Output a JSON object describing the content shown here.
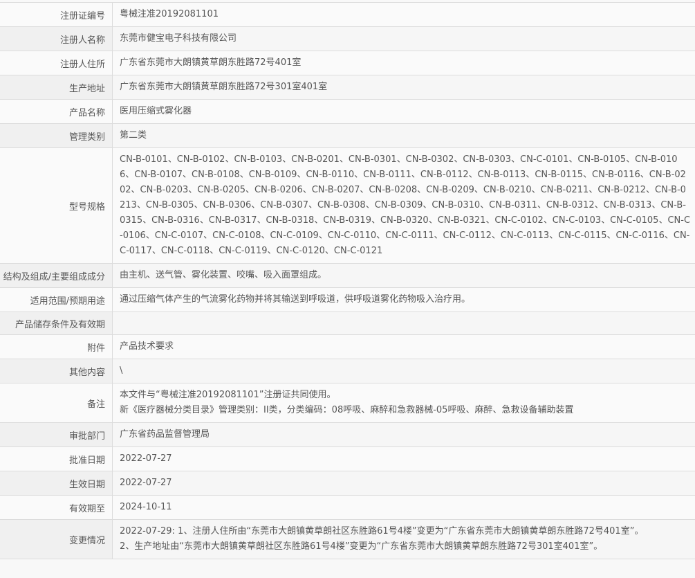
{
  "rows": [
    {
      "label": "注册证编号",
      "value": "粤械注准20192081101"
    },
    {
      "label": "注册人名称",
      "value": "东莞市健宝电子科技有限公司"
    },
    {
      "label": "注册人住所",
      "value": "广东省东莞市大朗镇黄草朗东胜路72号401室"
    },
    {
      "label": "生产地址",
      "value": "广东省东莞市大朗镇黄草朗东胜路72号301室401室"
    },
    {
      "label": "产品名称",
      "value": "医用压缩式雾化器"
    },
    {
      "label": "管理类别",
      "value": "第二类"
    },
    {
      "label": "型号规格",
      "value": "CN-B-0101、CN-B-0102、CN-B-0103、CN-B-0201、CN-B-0301、CN-B-0302、CN-B-0303、CN-C-0101、CN-B-0105、CN-B-0106、CN-B-0107、CN-B-0108、CN-B-0109、CN-B-0110、CN-B-0111、CN-B-0112、CN-B-0113、CN-B-0115、CN-B-0116、CN-B-0202、CN-B-0203、CN-B-0205、CN-B-0206、CN-B-0207、CN-B-0208、CN-B-0209、CN-B-0210、CN-B-0211、CN-B-0212、CN-B-0213、CN-B-0305、CN-B-0306、CN-B-0307、CN-B-0308、CN-B-0309、CN-B-0310、CN-B-0311、CN-B-0312、CN-B-0313、CN-B-0315、CN-B-0316、CN-B-0317、CN-B-0318、CN-B-0319、CN-B-0320、CN-B-0321、CN-C-0102、CN-C-0103、CN-C-0105、CN-C-0106、CN-C-0107、CN-C-0108、CN-C-0109、CN-C-0110、CN-C-0111、CN-C-0112、CN-C-0113、CN-C-0115、CN-C-0116、CN-C-0117、CN-C-0118、CN-C-0119、CN-C-0120、CN-C-0121"
    },
    {
      "label": "结构及组成/主要组成成分",
      "value": "由主机、送气管、雾化装置、咬嘴、吸入面罩组成。"
    },
    {
      "label": "适用范围/预期用途",
      "value": "通过压缩气体产生的气流雾化药物并将其输送到呼吸道，供呼吸道雾化药物吸入治疗用。"
    },
    {
      "label": "产品储存条件及有效期",
      "value": ""
    },
    {
      "label": "附件",
      "value": "产品技术要求"
    },
    {
      "label": "其他内容",
      "value": "\\"
    },
    {
      "label": "备注",
      "lines": [
        "本文件与“粤械注准20192081101”注册证共同使用。",
        "新《医疗器械分类目录》管理类别：II类，分类编码：08呼吸、麻醉和急救器械-05呼吸、麻醉、急救设备辅助装置"
      ]
    },
    {
      "label": "审批部门",
      "value": "广东省药品监督管理局"
    },
    {
      "label": "批准日期",
      "value": "2022-07-27"
    },
    {
      "label": "生效日期",
      "value": "2022-07-27"
    },
    {
      "label": "有效期至",
      "value": "2024-10-11"
    },
    {
      "label": "变更情况",
      "lines": [
        "2022-07-29: 1、注册人住所由“东莞市大朗镇黄草朗社区东胜路61号4楼”变更为“广东省东莞市大朗镇黄草朗东胜路72号401室”。",
        "2、生产地址由“东莞市大朗镇黄草朗社区东胜路61号4楼”变更为“广东省东莞市大朗镇黄草朗东胜路72号301室401室”。"
      ]
    }
  ]
}
